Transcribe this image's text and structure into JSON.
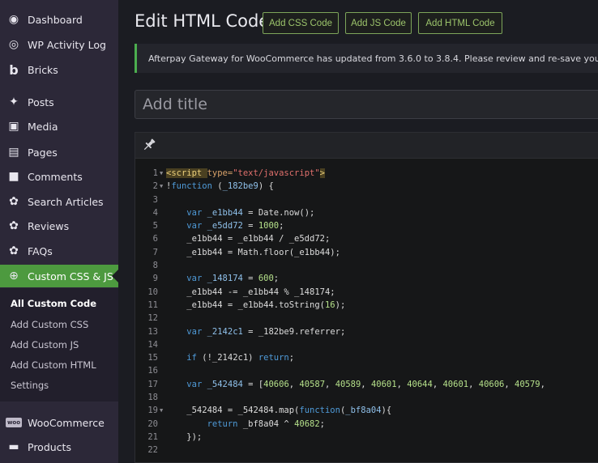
{
  "sidebar": {
    "items": [
      {
        "label": "Dashboard",
        "icon": "dashboard-icon",
        "glyph": "◉"
      },
      {
        "label": "WP Activity Log",
        "icon": "eye-icon",
        "glyph": "◎"
      },
      {
        "label": "Bricks",
        "icon": "bricks-logo-icon",
        "glyph": "b"
      },
      {
        "label": "Posts",
        "icon": "pin-icon",
        "glyph": "✦"
      },
      {
        "label": "Media",
        "icon": "media-icon",
        "glyph": "▣"
      },
      {
        "label": "Pages",
        "icon": "pages-icon",
        "glyph": "▤"
      },
      {
        "label": "Comments",
        "icon": "comment-icon",
        "glyph": "■"
      },
      {
        "label": "Search Articles",
        "icon": "gear-icon",
        "glyph": "✿"
      },
      {
        "label": "Reviews",
        "icon": "gear-icon",
        "glyph": "✿"
      },
      {
        "label": "FAQs",
        "icon": "gear-icon",
        "glyph": "✿"
      },
      {
        "label": "Custom CSS & JS",
        "icon": "plus-circle-icon",
        "glyph": "⊕"
      }
    ],
    "submenu": [
      {
        "label": "All Custom Code"
      },
      {
        "label": "Add Custom CSS"
      },
      {
        "label": "Add Custom JS"
      },
      {
        "label": "Add Custom HTML"
      },
      {
        "label": "Settings"
      }
    ],
    "bottom_items": [
      {
        "label": "WooCommerce",
        "icon": "woo-icon",
        "glyph": "woo"
      },
      {
        "label": "Products",
        "icon": "products-icon",
        "glyph": "▬"
      }
    ]
  },
  "header": {
    "title": "Edit HTML Code",
    "buttons": [
      "Add CSS Code",
      "Add JS Code",
      "Add HTML Code"
    ]
  },
  "notice": {
    "text": "Afterpay Gateway for WooCommerce has updated from 3.6.0 to 3.8.4. Please review and re-save your set"
  },
  "title_input": {
    "placeholder": "Add title"
  },
  "editor": {
    "toolbar_icon": "pin-icon",
    "lines": [
      {
        "n": "1",
        "fold": true,
        "tokens": [
          [
            "tag",
            "<script "
          ],
          [
            "attr",
            "type="
          ],
          [
            "str",
            "\"text/javascript\""
          ],
          [
            "tag",
            ">"
          ]
        ]
      },
      {
        "n": "2",
        "fold": true,
        "tokens": [
          [
            "plain",
            "!"
          ],
          [
            "kw",
            "function"
          ],
          [
            "plain",
            " ("
          ],
          [
            "var",
            "_182be9"
          ],
          [
            "plain",
            ") {"
          ]
        ]
      },
      {
        "n": "3",
        "fold": false,
        "tokens": []
      },
      {
        "n": "4",
        "fold": false,
        "tokens": [
          [
            "plain",
            "    "
          ],
          [
            "kw",
            "var"
          ],
          [
            "plain",
            " "
          ],
          [
            "var",
            "_e1bb44"
          ],
          [
            "plain",
            " = Date.now();"
          ]
        ]
      },
      {
        "n": "5",
        "fold": false,
        "tokens": [
          [
            "plain",
            "    "
          ],
          [
            "kw",
            "var"
          ],
          [
            "plain",
            " "
          ],
          [
            "var",
            "_e5dd72"
          ],
          [
            "plain",
            " = "
          ],
          [
            "num",
            "1000"
          ],
          [
            "plain",
            ";"
          ]
        ]
      },
      {
        "n": "6",
        "fold": false,
        "tokens": [
          [
            "plain",
            "    _e1bb44 = _e1bb44 / _e5dd72;"
          ]
        ]
      },
      {
        "n": "7",
        "fold": false,
        "tokens": [
          [
            "plain",
            "    _e1bb44 = Math.floor(_e1bb44);"
          ]
        ]
      },
      {
        "n": "8",
        "fold": false,
        "tokens": []
      },
      {
        "n": "9",
        "fold": false,
        "tokens": [
          [
            "plain",
            "    "
          ],
          [
            "kw",
            "var"
          ],
          [
            "plain",
            " "
          ],
          [
            "var",
            "_148174"
          ],
          [
            "plain",
            " = "
          ],
          [
            "num",
            "600"
          ],
          [
            "plain",
            ";"
          ]
        ]
      },
      {
        "n": "10",
        "fold": false,
        "tokens": [
          [
            "plain",
            "    _e1bb44 -= _e1bb44 % _148174;"
          ]
        ]
      },
      {
        "n": "11",
        "fold": false,
        "tokens": [
          [
            "plain",
            "    _e1bb44 = _e1bb44.toString("
          ],
          [
            "num",
            "16"
          ],
          [
            "plain",
            ");"
          ]
        ]
      },
      {
        "n": "12",
        "fold": false,
        "tokens": []
      },
      {
        "n": "13",
        "fold": false,
        "tokens": [
          [
            "plain",
            "    "
          ],
          [
            "kw",
            "var"
          ],
          [
            "plain",
            " "
          ],
          [
            "var",
            "_2142c1"
          ],
          [
            "plain",
            " = _182be9.referrer;"
          ]
        ]
      },
      {
        "n": "14",
        "fold": false,
        "tokens": []
      },
      {
        "n": "15",
        "fold": false,
        "tokens": [
          [
            "plain",
            "    "
          ],
          [
            "kw",
            "if"
          ],
          [
            "plain",
            " (!_2142c1) "
          ],
          [
            "kw",
            "return"
          ],
          [
            "plain",
            ";"
          ]
        ]
      },
      {
        "n": "16",
        "fold": false,
        "tokens": []
      },
      {
        "n": "17",
        "fold": false,
        "tokens": [
          [
            "plain",
            "    "
          ],
          [
            "kw",
            "var"
          ],
          [
            "plain",
            " "
          ],
          [
            "var",
            "_542484"
          ],
          [
            "plain",
            " = ["
          ],
          [
            "num",
            "40606"
          ],
          [
            "plain",
            ", "
          ],
          [
            "num",
            "40587"
          ],
          [
            "plain",
            ", "
          ],
          [
            "num",
            "40589"
          ],
          [
            "plain",
            ", "
          ],
          [
            "num",
            "40601"
          ],
          [
            "plain",
            ", "
          ],
          [
            "num",
            "40644"
          ],
          [
            "plain",
            ", "
          ],
          [
            "num",
            "40601"
          ],
          [
            "plain",
            ", "
          ],
          [
            "num",
            "40606"
          ],
          [
            "plain",
            ", "
          ],
          [
            "num",
            "40579"
          ],
          [
            "plain",
            ","
          ]
        ]
      },
      {
        "n": "18",
        "fold": false,
        "tokens": []
      },
      {
        "n": "19",
        "fold": true,
        "tokens": [
          [
            "plain",
            "    _542484 = _542484.map("
          ],
          [
            "kw",
            "function"
          ],
          [
            "plain",
            "("
          ],
          [
            "var",
            "_bf8a04"
          ],
          [
            "plain",
            "){"
          ]
        ]
      },
      {
        "n": "20",
        "fold": false,
        "tokens": [
          [
            "plain",
            "        "
          ],
          [
            "kw",
            "return"
          ],
          [
            "plain",
            " _bf8a04 ^ "
          ],
          [
            "num",
            "40682"
          ],
          [
            "plain",
            ";"
          ]
        ]
      },
      {
        "n": "21",
        "fold": false,
        "tokens": [
          [
            "plain",
            "    });"
          ]
        ]
      },
      {
        "n": "22",
        "fold": false,
        "tokens": []
      }
    ]
  }
}
